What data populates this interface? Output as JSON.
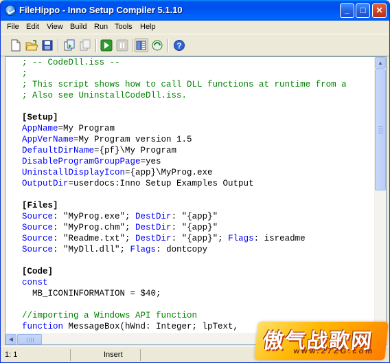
{
  "window": {
    "title": "FileHippo - Inno Setup Compiler 5.1.10"
  },
  "titlebar_buttons": {
    "minimize": "_",
    "maximize": "□",
    "close": "✕"
  },
  "menu": [
    "File",
    "Edit",
    "View",
    "Build",
    "Run",
    "Tools",
    "Help"
  ],
  "toolbar": {
    "icons": [
      "new-file-icon",
      "open-folder-icon",
      "save-icon",
      "compile-icon",
      "stop-compile-icon",
      "run-icon",
      "pause-icon",
      "target-setup-icon",
      "target-uninstall-icon",
      "help-icon"
    ]
  },
  "editor": {
    "lines": [
      {
        "parts": [
          {
            "t": "; -- CodeDll.iss --",
            "c": "comment"
          }
        ]
      },
      {
        "parts": [
          {
            "t": ";",
            "c": "comment"
          }
        ]
      },
      {
        "parts": [
          {
            "t": "; This script shows how to call DLL functions at runtime from a",
            "c": "comment"
          }
        ]
      },
      {
        "parts": [
          {
            "t": "; Also see UninstallCodeDll.iss.",
            "c": "comment"
          }
        ]
      },
      {
        "parts": []
      },
      {
        "parts": [
          {
            "t": "[Setup]",
            "c": "section"
          }
        ]
      },
      {
        "parts": [
          {
            "t": "AppName",
            "c": "key"
          },
          {
            "t": "=My Program",
            "c": "text"
          }
        ]
      },
      {
        "parts": [
          {
            "t": "AppVerName",
            "c": "key"
          },
          {
            "t": "=My Program version 1.5",
            "c": "text"
          }
        ]
      },
      {
        "parts": [
          {
            "t": "DefaultDirName",
            "c": "key"
          },
          {
            "t": "={pf}\\My Program",
            "c": "text"
          }
        ]
      },
      {
        "parts": [
          {
            "t": "DisableProgramGroupPage",
            "c": "key"
          },
          {
            "t": "=yes",
            "c": "text"
          }
        ]
      },
      {
        "parts": [
          {
            "t": "UninstallDisplayIcon",
            "c": "key"
          },
          {
            "t": "={app}\\MyProg.exe",
            "c": "text"
          }
        ]
      },
      {
        "parts": [
          {
            "t": "OutputDir",
            "c": "key"
          },
          {
            "t": "=userdocs:Inno Setup Examples Output",
            "c": "text"
          }
        ]
      },
      {
        "parts": []
      },
      {
        "parts": [
          {
            "t": "[Files]",
            "c": "section"
          }
        ]
      },
      {
        "parts": [
          {
            "t": "Source",
            "c": "key"
          },
          {
            "t": ": \"MyProg.exe\"; ",
            "c": "text"
          },
          {
            "t": "DestDir",
            "c": "key"
          },
          {
            "t": ": \"{app}\"",
            "c": "text"
          }
        ]
      },
      {
        "parts": [
          {
            "t": "Source",
            "c": "key"
          },
          {
            "t": ": \"MyProg.chm\"; ",
            "c": "text"
          },
          {
            "t": "DestDir",
            "c": "key"
          },
          {
            "t": ": \"{app}\"",
            "c": "text"
          }
        ]
      },
      {
        "parts": [
          {
            "t": "Source",
            "c": "key"
          },
          {
            "t": ": \"Readme.txt\"; ",
            "c": "text"
          },
          {
            "t": "DestDir",
            "c": "key"
          },
          {
            "t": ": \"{app}\"; ",
            "c": "text"
          },
          {
            "t": "Flags",
            "c": "key"
          },
          {
            "t": ": isreadme",
            "c": "text"
          }
        ]
      },
      {
        "parts": [
          {
            "t": "Source",
            "c": "key"
          },
          {
            "t": ": \"MyDll.dll\"; ",
            "c": "text"
          },
          {
            "t": "Flags",
            "c": "key"
          },
          {
            "t": ": dontcopy",
            "c": "text"
          }
        ]
      },
      {
        "parts": []
      },
      {
        "parts": [
          {
            "t": "[Code]",
            "c": "section"
          }
        ]
      },
      {
        "parts": [
          {
            "t": "const",
            "c": "key"
          }
        ]
      },
      {
        "parts": [
          {
            "t": "  MB_ICONINFORMATION = $40;",
            "c": "text"
          }
        ]
      },
      {
        "parts": []
      },
      {
        "parts": [
          {
            "t": "//importing a Windows API function",
            "c": "comment"
          }
        ]
      },
      {
        "parts": [
          {
            "t": "function",
            "c": "key"
          },
          {
            "t": " MessageBox(hWnd: Integer; lpText,",
            "c": "text"
          }
        ]
      }
    ]
  },
  "status": {
    "position": "1:   1",
    "mode": "Insert"
  },
  "watermark": {
    "text": "傲气战歌网",
    "url": "www.27ZG.com"
  }
}
